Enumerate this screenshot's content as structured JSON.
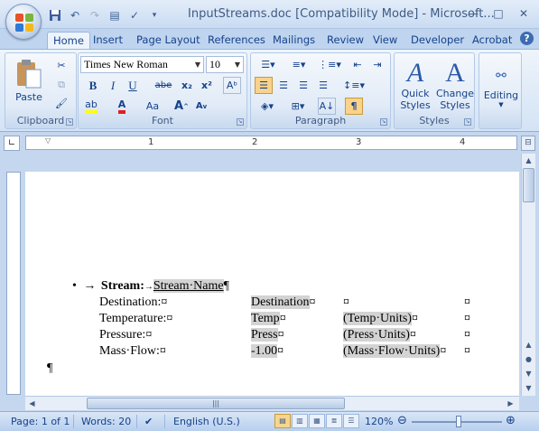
{
  "window": {
    "title": "InputStreams.doc [Compatibility Mode] - Microsoft..."
  },
  "tabs": [
    "Home",
    "Insert",
    "Page Layout",
    "References",
    "Mailings",
    "Review",
    "View",
    "Developer",
    "Acrobat"
  ],
  "ribbon": {
    "clipboard": {
      "label": "Clipboard",
      "paste_label": "Paste"
    },
    "font": {
      "label": "Font",
      "font_name": "Times New Roman",
      "font_size": "10"
    },
    "paragraph": {
      "label": "Paragraph"
    },
    "styles": {
      "label": "Styles",
      "quick_styles": "Quick",
      "quick_styles_2": "Styles",
      "change_styles": "Change",
      "change_styles_2": "Styles"
    },
    "editing": {
      "label": "Editing"
    }
  },
  "ruler": {
    "marks": [
      "1",
      "2",
      "3",
      "4"
    ]
  },
  "document": {
    "heading_label": "Stream:",
    "heading_field": "Stream·Name",
    "pilcrow": "¶",
    "rows": [
      {
        "label": "Destination:¤",
        "value": "Destination",
        "value_mark": "¤",
        "units": "",
        "units_mark": "¤",
        "end": "¤"
      },
      {
        "label": "Temperature:¤",
        "value": "Temp",
        "value_mark": "¤",
        "units": "(Temp·Units)",
        "units_mark": "¤",
        "end": "¤"
      },
      {
        "label": "Pressure:¤",
        "value": "Press",
        "value_mark": "¤",
        "units": "(Press·Units)",
        "units_mark": "¤",
        "end": "¤"
      },
      {
        "label": "Mass·Flow:¤",
        "value": "-1.00",
        "value_mark": "¤",
        "units": "(Mass·Flow·Units)",
        "units_mark": "¤",
        "end": "¤"
      }
    ]
  },
  "statusbar": {
    "page": "Page: 1 of 1",
    "words": "Words: 20",
    "language": "English (U.S.)",
    "zoom": "120%"
  },
  "colors": {
    "accent": "#15428b",
    "field_shading": "#d3d3d3"
  }
}
